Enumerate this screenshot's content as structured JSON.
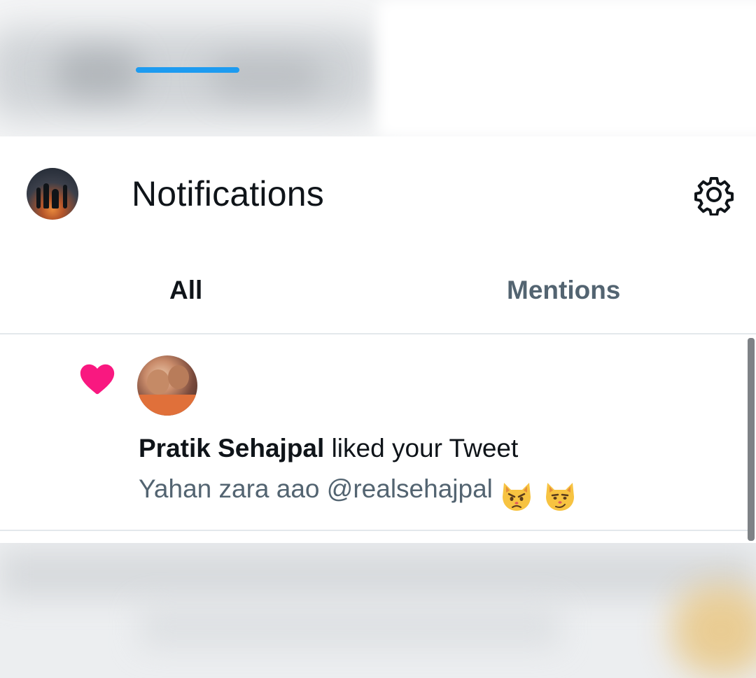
{
  "header": {
    "title": "Notifications",
    "settings_icon": "gear-icon"
  },
  "tabs": [
    {
      "label": "All",
      "selected": true
    },
    {
      "label": "Mentions",
      "selected": false
    }
  ],
  "notifications": [
    {
      "type_icon": "heart-icon",
      "type_color": "#f91880",
      "user_name": "Pratik Sehajpal",
      "action": "liked your Tweet",
      "tweet_text": "Yahan zara aao @realsehajpal",
      "emojis": [
        "pouting-cat-emoji",
        "smirking-cat-emoji"
      ]
    }
  ],
  "colors": {
    "accent": "#1d9bf0",
    "like": "#f91880",
    "primary_text": "#0f1419",
    "secondary_text": "#536471"
  }
}
